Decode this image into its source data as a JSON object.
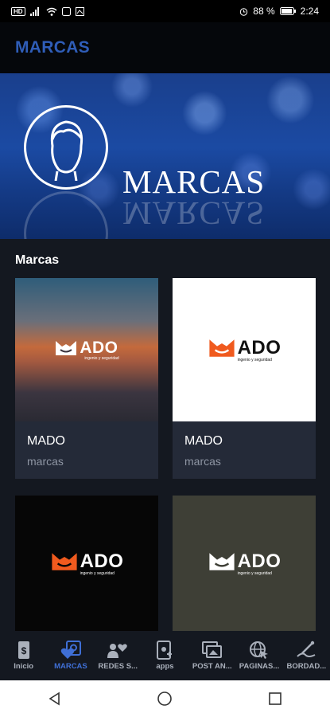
{
  "status_bar": {
    "left_chip": "HD",
    "battery": "88 %",
    "time": "2:24"
  },
  "app_bar": {
    "title": "MARCAS"
  },
  "hero": {
    "title": "MARCAS"
  },
  "section": {
    "title": "Marcas"
  },
  "cards": [
    {
      "title": "MADO",
      "subtitle": "marcas",
      "logo_word": "ADO",
      "tagline": "ingenio y seguridad"
    },
    {
      "title": "MADO",
      "subtitle": "marcas",
      "logo_word": "ADO",
      "tagline": "ingenio y seguridad"
    },
    {
      "logo_word": "ADO",
      "tagline": "ingenio y seguridad"
    },
    {
      "logo_word": "ADO",
      "tagline": "ingenio y seguridad"
    }
  ],
  "nav": [
    {
      "label": "Inicio",
      "icon": "phone-dollar-icon"
    },
    {
      "label": "MARCAS",
      "icon": "heart-badge-icon"
    },
    {
      "label": "REDES S...",
      "icon": "people-heart-icon"
    },
    {
      "label": "apps",
      "icon": "phone-add-icon"
    },
    {
      "label": "POST AN...",
      "icon": "images-icon"
    },
    {
      "label": "PAGINAS...",
      "icon": "globe-cursor-icon"
    },
    {
      "label": "BORDAD...",
      "icon": "needle-icon"
    }
  ],
  "colors": {
    "accent": "#2f5db8",
    "active_nav": "#3f6fd6",
    "logo_orange": "#f05a1e"
  }
}
